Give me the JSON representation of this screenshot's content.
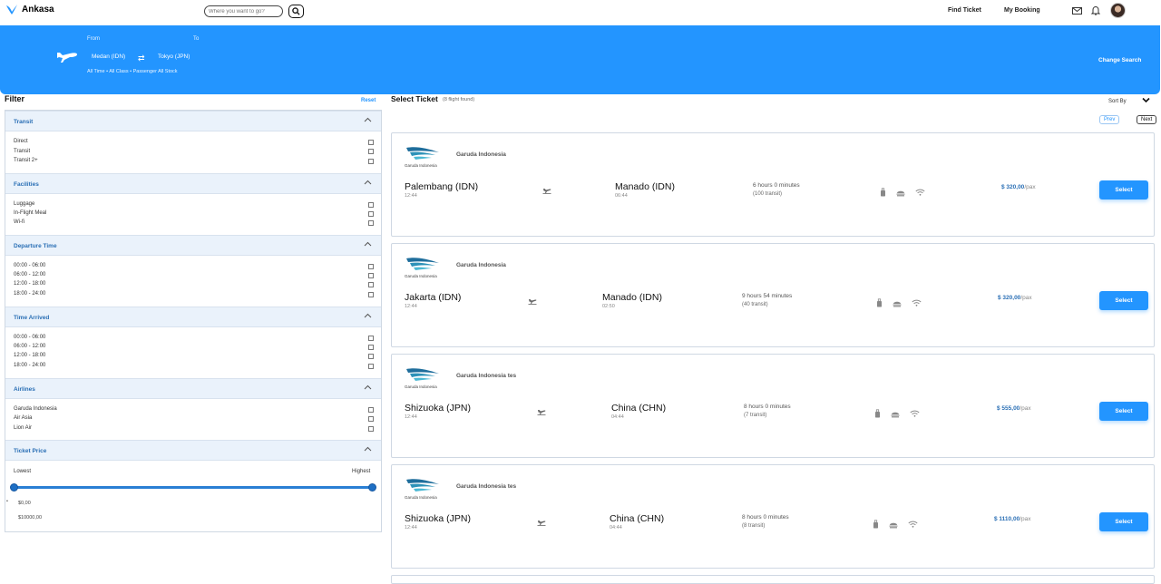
{
  "nav": {
    "brand": "Ankasa",
    "search_placeholder": "Where you want to go?",
    "links": [
      "Find Ticket",
      "My Booking"
    ],
    "icons": [
      "mail-icon",
      "bell-icon",
      "avatar"
    ]
  },
  "hero": {
    "from_label": "From",
    "to_label": "To",
    "from_city": "Medan (IDN)",
    "to_city": "Tokyo (JPN)",
    "meta": "All Time • All Class • Passenger All Stock",
    "change_search": "Change Search"
  },
  "filter": {
    "title": "Filter",
    "reset": "Reset",
    "sections": [
      {
        "title": "Transit",
        "options": [
          "Direct",
          "Transit",
          "Transit 2+"
        ]
      },
      {
        "title": "Facilities",
        "options": [
          "Luggage",
          "In-Flight Meal",
          "Wi-fi"
        ]
      },
      {
        "title": "Departure Time",
        "options": [
          "00:00 - 06:00",
          "06:00 - 12:00",
          "12:00 - 18:00",
          "18:00 - 24:00"
        ]
      },
      {
        "title": "Time Arrived",
        "options": [
          "00:00 - 06:00",
          "06:00 - 12:00",
          "12:00 - 18:00",
          "18:00 - 24:00"
        ]
      },
      {
        "title": "Airlines",
        "options": [
          "Garuda Indonesia",
          "Air Asia",
          "Lion Air"
        ]
      },
      {
        "title": "Ticket Price",
        "options": []
      }
    ],
    "price": {
      "lowest_label": "Lowest",
      "highest_label": "Highest",
      "min": "$0,00",
      "max": "$10000,00"
    }
  },
  "results": {
    "title": "Select Ticket",
    "count": "(8 flight found)",
    "sort_label": "Sort By",
    "prev": "Prev",
    "next": "Next",
    "logo_caption": "Garuda Indonesia",
    "select_label": "Select",
    "pax": "/pax",
    "tickets": [
      {
        "airline": "Garuda Indonesia",
        "from": "Palembang (IDN)",
        "from_time": "12:44",
        "to": "Manado (IDN)",
        "to_time": "06:44",
        "duration": "6 hours 0 minutes",
        "transit": "(100 transit)",
        "price": "$ 320,00"
      },
      {
        "airline": "Garuda Indonesia",
        "from": "Jakarta (IDN)",
        "from_time": "12:44",
        "to": "Manado (IDN)",
        "to_time": "02:50",
        "duration": "9 hours 54 minutes",
        "transit": "(40 transit)",
        "price": "$ 320,00"
      },
      {
        "airline": "Garuda Indonesia tes",
        "from": "Shizuoka (JPN)",
        "from_time": "12:44",
        "to": "China (CHN)",
        "to_time": "04:44",
        "duration": "8 hours 0 minutes",
        "transit": "(7 transit)",
        "price": "$ 555,00"
      },
      {
        "airline": "Garuda Indonesia tes",
        "from": "Shizuoka (JPN)",
        "from_time": "12:44",
        "to": "China (CHN)",
        "to_time": "04:44",
        "duration": "8 hours 0 minutes",
        "transit": "(8 transit)",
        "price": "$ 1110,00"
      }
    ]
  }
}
